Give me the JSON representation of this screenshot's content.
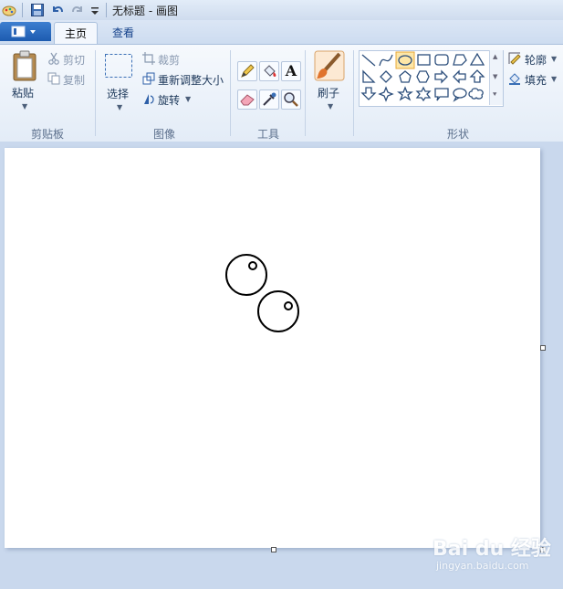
{
  "window": {
    "title": "无标题 - 画图"
  },
  "tabs": [
    {
      "label": "主页"
    },
    {
      "label": "查看"
    }
  ],
  "clipboard": {
    "paste": "粘贴",
    "cut": "剪切",
    "copy": "复制",
    "group": "剪贴板"
  },
  "image": {
    "select": "选择",
    "crop": "裁剪",
    "resize": "重新调整大小",
    "rotate": "旋转",
    "group": "图像"
  },
  "tools": {
    "group": "工具",
    "text_glyph": "A"
  },
  "brush": {
    "label": "刷子"
  },
  "shapes": {
    "group": "形状",
    "outline": "轮廓",
    "fill": "填充"
  },
  "watermark": {
    "brand": "Bai du 经验",
    "url": "jingyan.baidu.com"
  },
  "colors": {
    "accent": "#1d5bb0",
    "highlight": "#f6c75d"
  }
}
